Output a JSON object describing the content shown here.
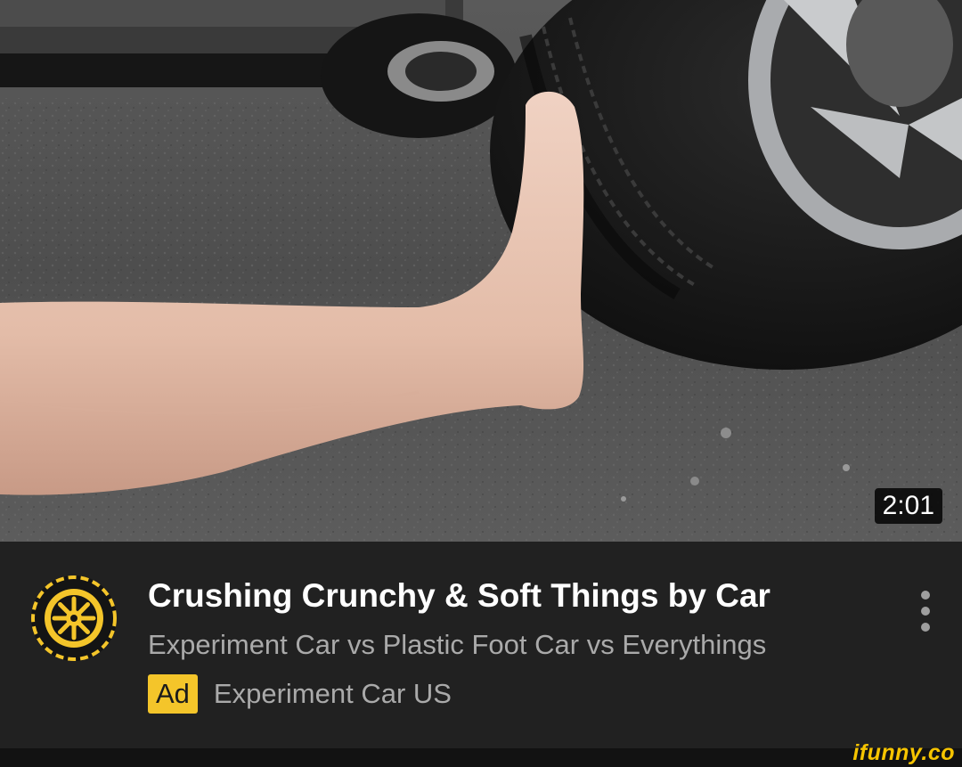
{
  "video": {
    "duration": "2:01",
    "title": "Crushing Crunchy & Soft Things by Car",
    "description": "Experiment Car vs Plastic Foot Car vs Everythings",
    "ad_badge": "Ad",
    "advertiser": "Experiment Car US"
  },
  "icons": {
    "avatar": "yellow-wheel-logo-icon",
    "more": "vertical-ellipsis-icon"
  },
  "colors": {
    "panel_background": "#212121",
    "title_text": "#ffffff",
    "secondary_text": "#aaaaaa",
    "ad_badge": "#f4c52a",
    "watermark": "#f6c400"
  },
  "watermark": "ifunny.co"
}
